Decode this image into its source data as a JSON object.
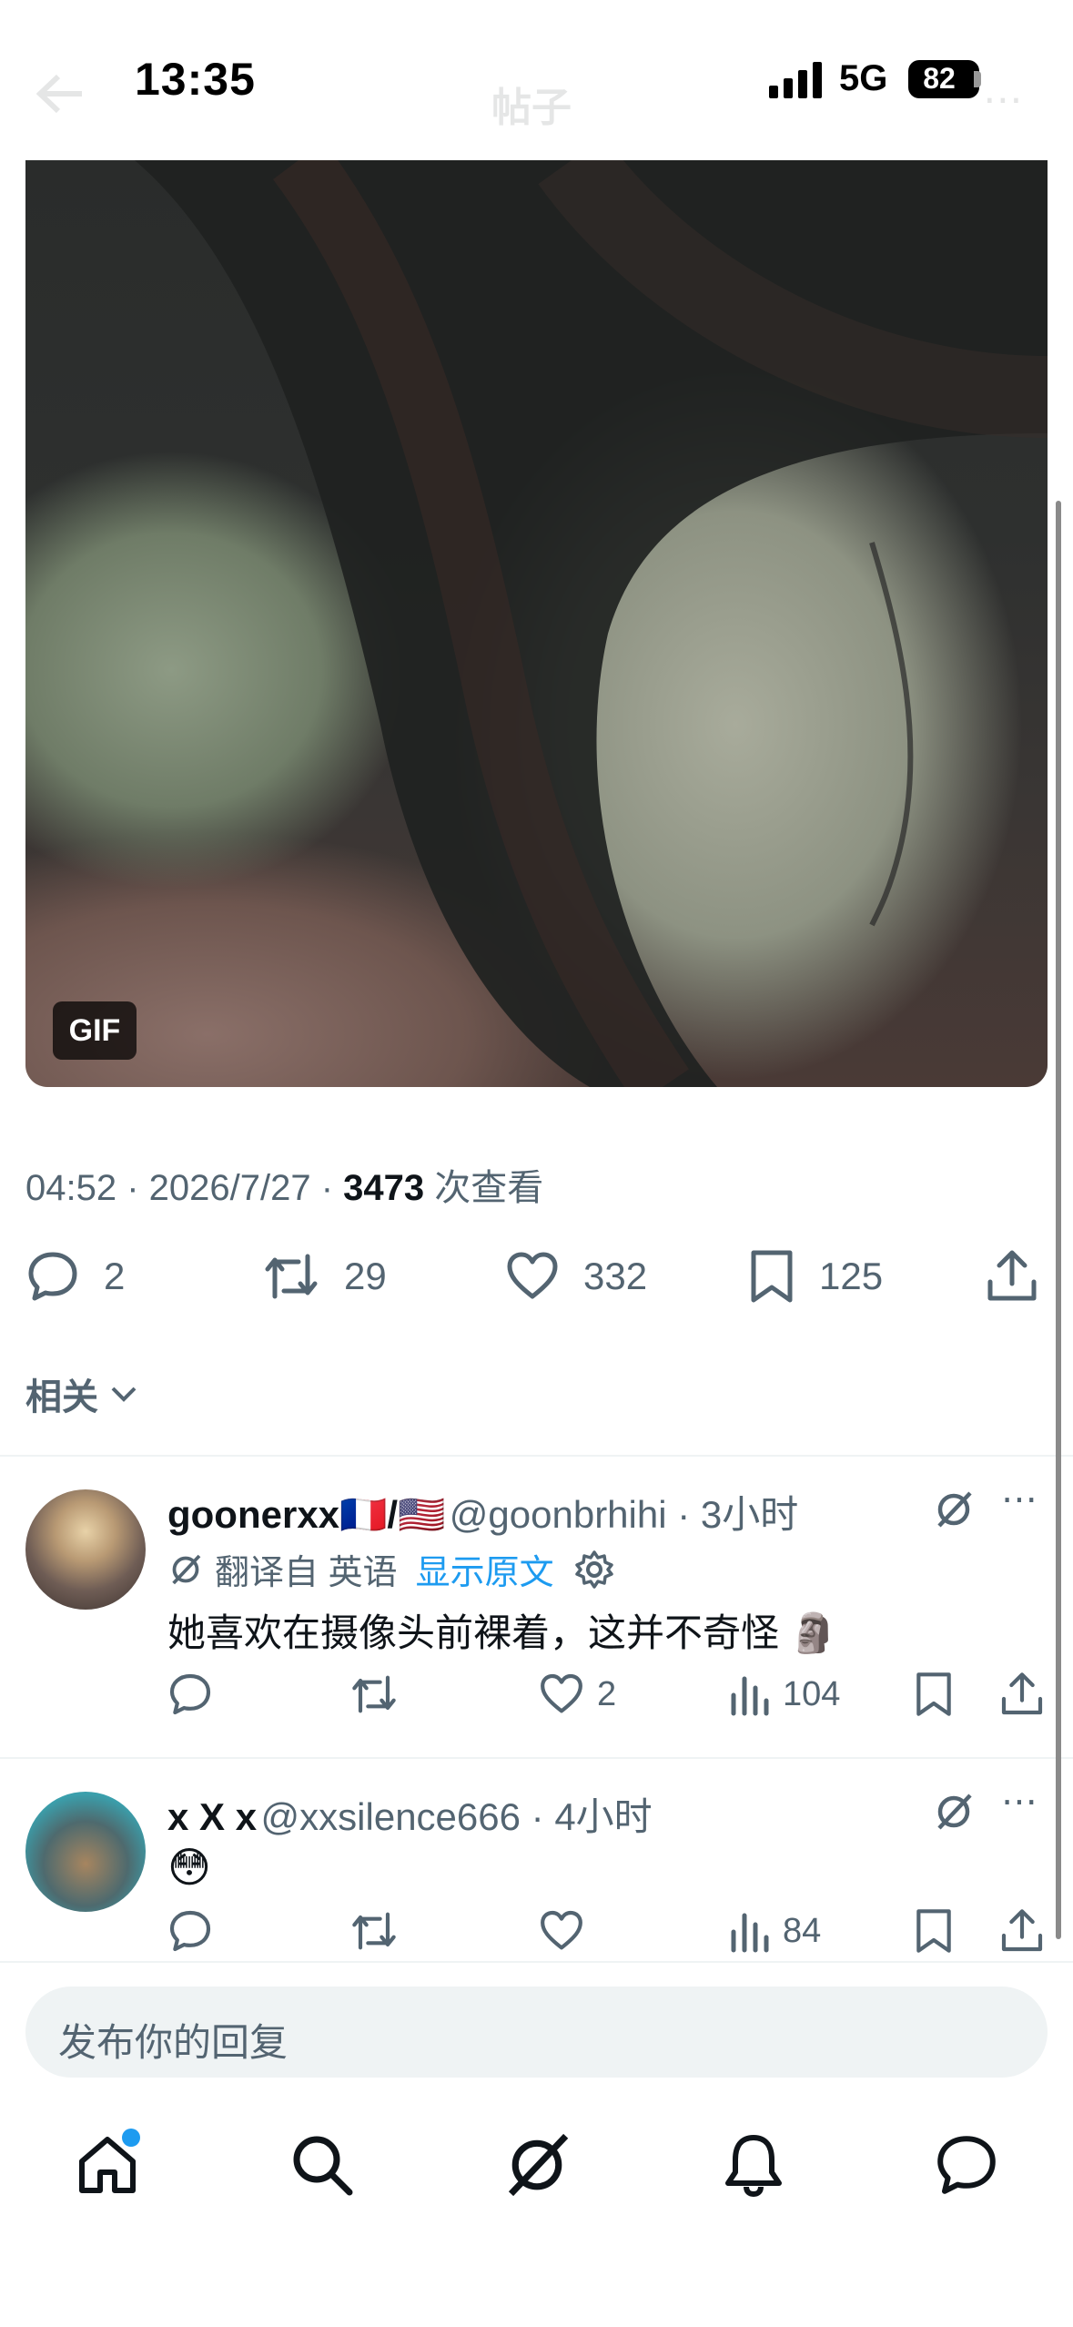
{
  "status_bar": {
    "time": "13:35",
    "network": "5G",
    "battery": "82"
  },
  "header": {
    "title": "帖子"
  },
  "post": {
    "media_badge": "GIF",
    "time": "04:52",
    "date": "2026/7/27",
    "views": "3473",
    "views_label": "次查看",
    "replies": "2",
    "reposts": "29",
    "likes": "332",
    "bookmarks": "125"
  },
  "related": {
    "label": "相关"
  },
  "replies": [
    {
      "name": "goonerxx🇫🇷/🇺🇸",
      "handle": "@goonbrhihi",
      "time": "3小时",
      "translated_from": "翻译自 英语",
      "show_original": "显示原文",
      "text": "她喜欢在摄像头前裸着，这并不奇怪 🗿",
      "replies": "",
      "reposts": "",
      "likes": "2",
      "views": "104"
    },
    {
      "name": "x X x",
      "handle": "@xxsilence666",
      "time": "4小时",
      "text": "😳",
      "replies": "",
      "reposts": "",
      "likes": "",
      "views": "84"
    }
  ],
  "composer": {
    "placeholder": "发布你的回复"
  },
  "colors": {
    "text": "#0f1419",
    "secondary": "#536471",
    "accent": "#1d9bf0",
    "divider": "#eff3f4"
  }
}
